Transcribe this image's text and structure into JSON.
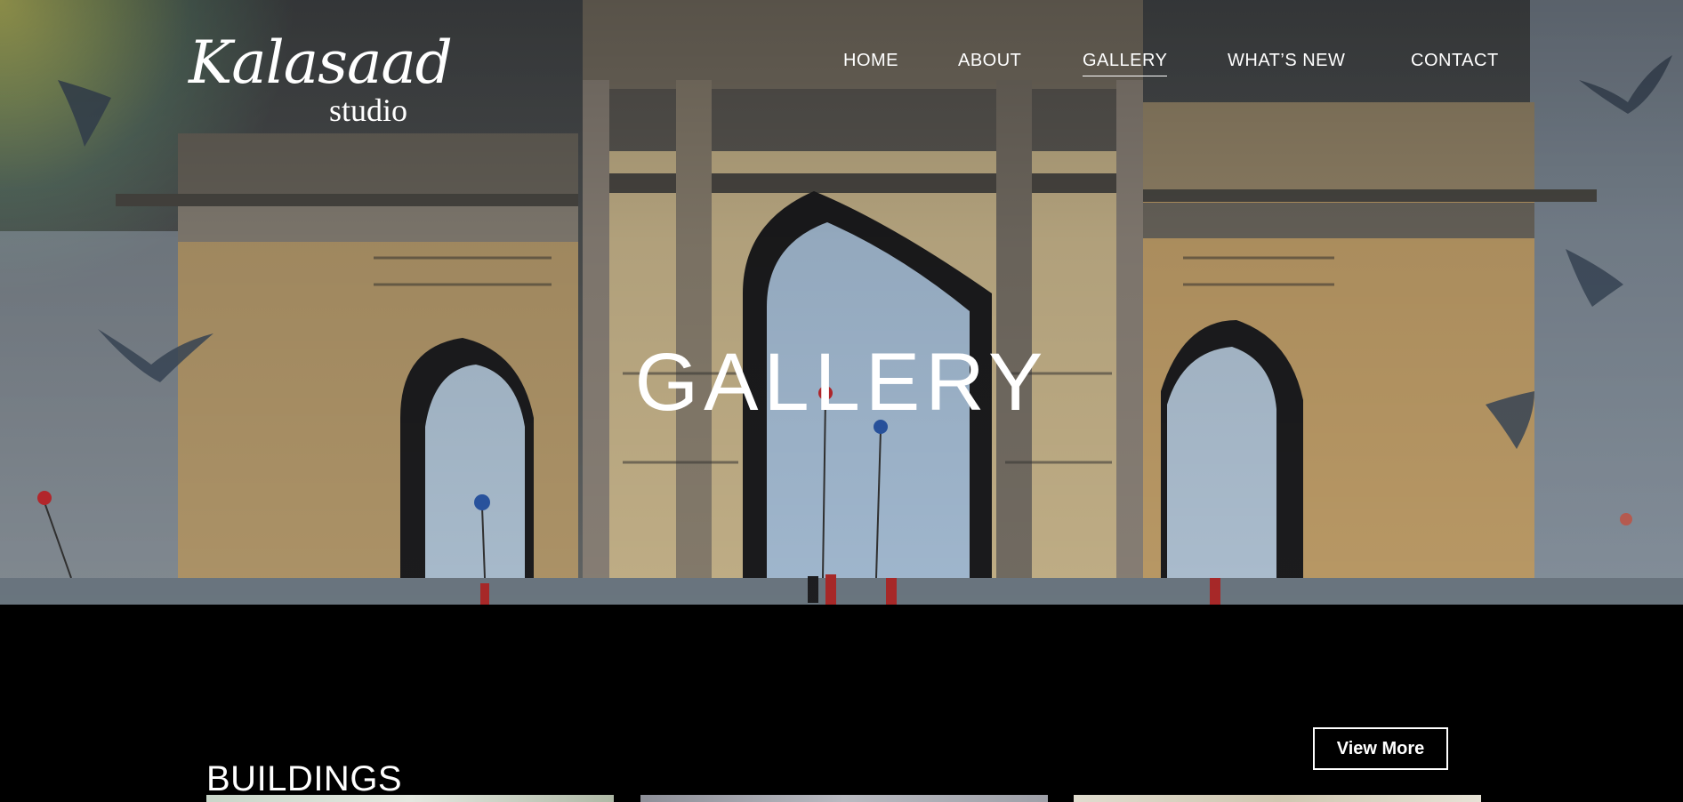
{
  "logo": {
    "script": "Kalasaad",
    "sub": "studio"
  },
  "nav": {
    "items": [
      {
        "label": "HOME"
      },
      {
        "label": "ABOUT"
      },
      {
        "label": "GALLERY"
      },
      {
        "label": "WHAT’S NEW"
      },
      {
        "label": "CONTACT"
      }
    ],
    "active": "GALLERY"
  },
  "hero": {
    "title": "GALLERY"
  },
  "section": {
    "title": "BUILDINGS",
    "button_label": "View More"
  },
  "colors": {
    "background": "#000000",
    "text": "#ffffff",
    "accent_glow": "#fff65a"
  }
}
